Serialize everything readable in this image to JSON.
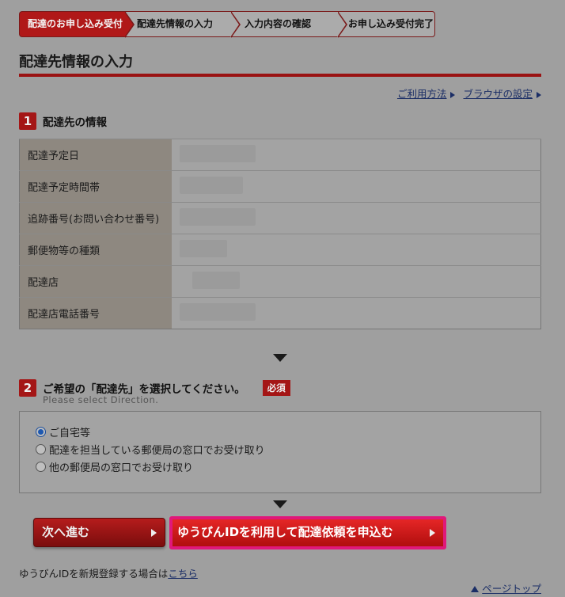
{
  "steps": [
    {
      "label": "配達のお申し込み受付",
      "active": true
    },
    {
      "label": "配達先情報の入力",
      "active": false
    },
    {
      "label": "入力内容の確認",
      "active": false
    },
    {
      "label": "お申し込み受付完了",
      "active": false
    }
  ],
  "page_title": "配達先情報の入力",
  "help_links": {
    "usage": "ご利用方法",
    "browser": "ブラウザの設定"
  },
  "section1": {
    "number": "1",
    "title": "配達先の情報",
    "rows": [
      {
        "label": "配達予定日"
      },
      {
        "label": "配達予定時間帯"
      },
      {
        "label": "追跡番号(お問い合わせ番号)"
      },
      {
        "label": "郵便物等の種類"
      },
      {
        "label": "配達店"
      },
      {
        "label": "配達店電話番号"
      }
    ]
  },
  "section2": {
    "number": "2",
    "title": "ご希望の「配達先」を選択してください。",
    "required": "必須",
    "subtitle": "Please select Direction.",
    "options": [
      {
        "label": "ご自宅等",
        "checked": true
      },
      {
        "label": "配達を担当している郵便局の窓口でお受け取り",
        "checked": false
      },
      {
        "label": "他の郵便局の窓口でお受け取り",
        "checked": false
      }
    ]
  },
  "buttons": {
    "next": "次へ進む",
    "yu_id": "ゆうびんIDを利用して配達依頼を申込む"
  },
  "register": {
    "text": "ゆうびんIDを新規登録する場合は",
    "link": "こちら"
  },
  "pagetop": "ページトップ",
  "colors": {
    "brand_red": "#a41616",
    "highlight_pink": "#e0187a",
    "link_blue": "#1b2e66"
  }
}
